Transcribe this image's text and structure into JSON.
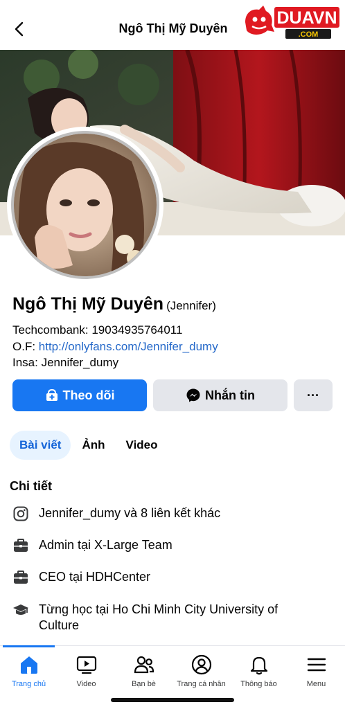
{
  "header": {
    "title": "Ngô Thị Mỹ Duyên",
    "logo_text": "DUAVN",
    "logo_sub": ".COM"
  },
  "profile": {
    "name": "Ngô Thị Mỹ Duyên",
    "alt_name": "(Jennifer)",
    "bio_line1": "Techcombank: 19034935764011",
    "bio_line2_prefix": "O.F: ",
    "bio_line2_link": "http://onlyfans.com/Jennifer_dumy",
    "bio_line3": "Insa: Jennifer_dumy"
  },
  "actions": {
    "follow_label": "Theo dõi",
    "message_label": "Nhắn tin",
    "more_label": "···"
  },
  "tabs": [
    {
      "label": "Bài viết",
      "active": true
    },
    {
      "label": "Ảnh",
      "active": false
    },
    {
      "label": "Video",
      "active": false
    }
  ],
  "details": {
    "title": "Chi tiết",
    "items": [
      {
        "icon": "instagram-icon",
        "text": "Jennifer_dumy và 8 liên kết khác"
      },
      {
        "icon": "briefcase-icon",
        "text": "Admin tại X-Large Team"
      },
      {
        "icon": "briefcase-icon",
        "text": "CEO tại HDHCenter"
      },
      {
        "icon": "graduation-cap-icon",
        "text": "Từng học tại Ho Chi Minh City University of Culture"
      }
    ]
  },
  "bottom_nav": [
    {
      "label": "Trang chủ",
      "icon": "home-icon",
      "active": true
    },
    {
      "label": "Video",
      "icon": "video-icon",
      "active": false
    },
    {
      "label": "Bạn bè",
      "icon": "friends-icon",
      "active": false
    },
    {
      "label": "Trang cá nhân",
      "icon": "profile-icon",
      "active": false
    },
    {
      "label": "Thông báo",
      "icon": "bell-icon",
      "active": false
    },
    {
      "label": "Menu",
      "icon": "menu-icon",
      "active": false
    }
  ],
  "colors": {
    "accent": "#1877f2",
    "link": "#2468c9",
    "button_gray": "#e4e6eb",
    "tab_active_bg": "#e7f3ff"
  }
}
